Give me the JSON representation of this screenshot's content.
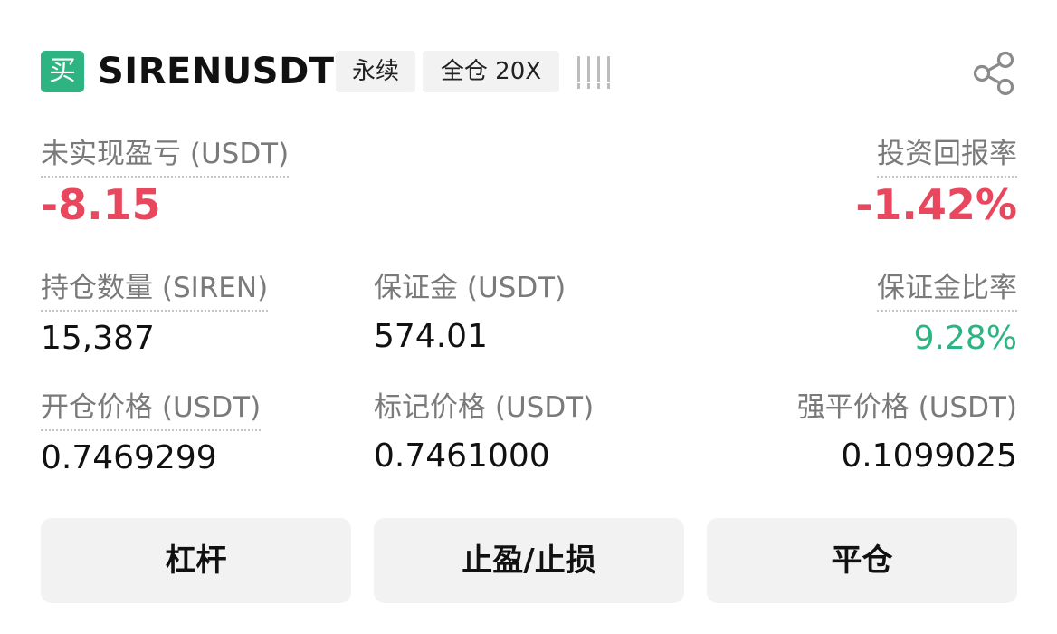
{
  "header": {
    "side_label": "买",
    "symbol": "SIRENUSDT",
    "contract_type": "永续",
    "margin_mode": "全仓 20X",
    "adl_indicator": "adl-level-icon",
    "share_icon": "share-icon"
  },
  "stats": {
    "unrealized_pnl": {
      "label": "未实现盈亏 (USDT)",
      "value": "-8.15"
    },
    "roi": {
      "label": "投资回报率",
      "value": "-1.42%"
    },
    "position_size": {
      "label": "持仓数量 (SIREN)",
      "value": "15,387"
    },
    "margin": {
      "label": "保证金 (USDT)",
      "value": "574.01"
    },
    "margin_ratio": {
      "label": "保证金比率",
      "value": "9.28%"
    },
    "entry_price": {
      "label": "开仓价格 (USDT)",
      "value": "0.7469299"
    },
    "mark_price": {
      "label": "标记价格 (USDT)",
      "value": "0.7461000"
    },
    "liq_price": {
      "label": "强平价格 (USDT)",
      "value": "0.1099025"
    }
  },
  "actions": {
    "leverage": "杠杆",
    "tp_sl": "止盈/止损",
    "close": "平仓"
  },
  "colors": {
    "buy_green": "#2eb482",
    "loss_red": "#e8475d",
    "button_bg": "#f2f2f2"
  }
}
